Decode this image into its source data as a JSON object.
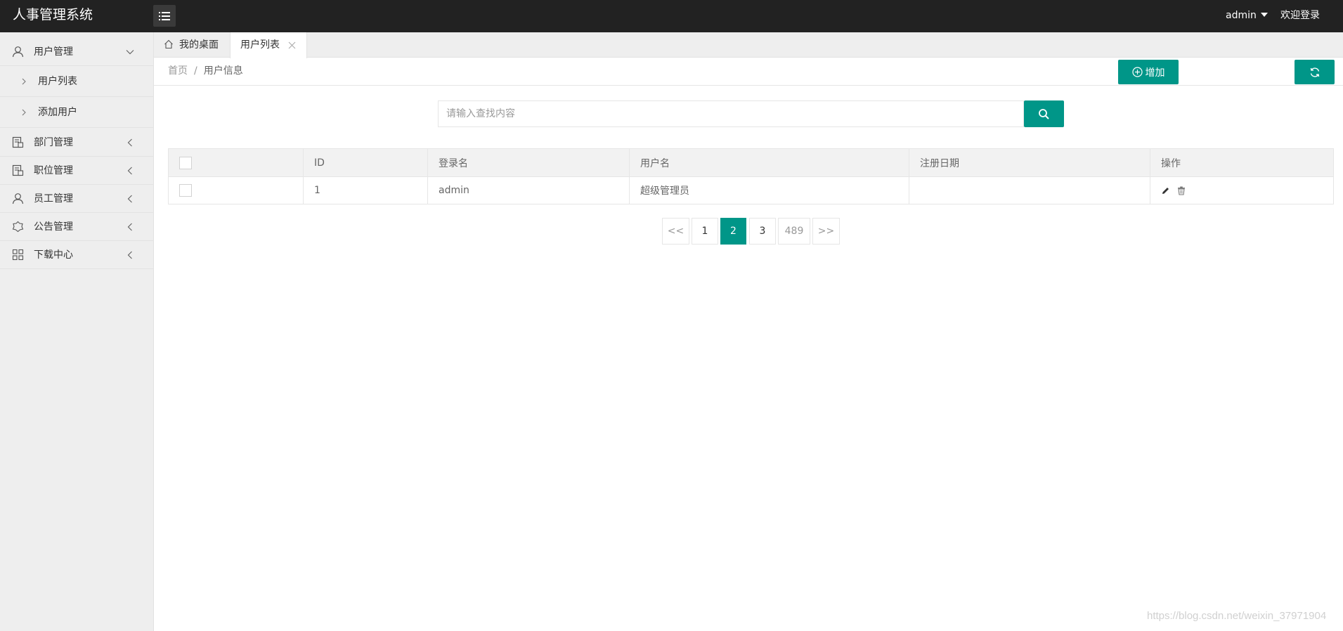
{
  "app": {
    "title": "人事管理系统",
    "user": "admin",
    "welcome": "欢迎登录"
  },
  "sidebar": {
    "items": [
      {
        "label": "用户管理",
        "icon": "user-icon",
        "expanded": true,
        "children": [
          {
            "label": "用户列表"
          },
          {
            "label": "添加用户"
          }
        ]
      },
      {
        "label": "部门管理",
        "icon": "department-icon"
      },
      {
        "label": "职位管理",
        "icon": "position-icon"
      },
      {
        "label": "员工管理",
        "icon": "employee-icon"
      },
      {
        "label": "公告管理",
        "icon": "notice-icon"
      },
      {
        "label": "下载中心",
        "icon": "grid-icon"
      }
    ]
  },
  "tabs": [
    {
      "label": "我的桌面",
      "icon": "home-icon"
    },
    {
      "label": "用户列表",
      "active": true,
      "closable": true
    }
  ],
  "breadcrumb": {
    "home": "首页",
    "separator": "/",
    "current": "用户信息"
  },
  "toolbar": {
    "add_label": "增加"
  },
  "search": {
    "placeholder": "请输入查找内容"
  },
  "table": {
    "headers": [
      "",
      "ID",
      "登录名",
      "用户名",
      "注册日期",
      "操作"
    ],
    "rows": [
      {
        "id": "1",
        "login": "admin",
        "username": "超级管理员",
        "date": ""
      }
    ]
  },
  "pagination": {
    "prev": "<<",
    "pages": [
      "1",
      "2",
      "3",
      "489"
    ],
    "current": "2",
    "next": ">>"
  },
  "watermark": "https://blog.csdn.net/weixin_37971904",
  "colors": {
    "accent": "#009688",
    "topbar": "#222222",
    "sidebar": "#eeeeee"
  }
}
